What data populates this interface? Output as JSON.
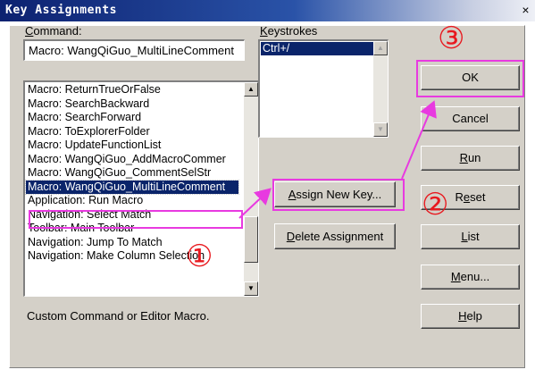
{
  "window": {
    "title": "Key Assignments",
    "close_glyph": "×"
  },
  "command": {
    "label_pre": "",
    "label_u": "C",
    "label_post": "ommand:",
    "value": "Macro: WangQiGuo_MultiLineComment"
  },
  "commands_list": {
    "items": [
      "Macro: ReturnTrueOrFalse",
      "Macro: SearchBackward",
      "Macro: SearchForward",
      "Macro: ToExplorerFolder",
      "Macro: UpdateFunctionList",
      "Macro: WangQiGuo_AddMacroCommer",
      "Macro: WangQiGuo_CommentSelStr",
      "Macro: WangQiGuo_MultiLineComment",
      "Application: Run Macro",
      "Navigation: Select Match",
      "Toolbar: Main Toolbar",
      "Navigation: Jump To Match",
      "Navigation: Make Column Selection"
    ],
    "selected_index": 7
  },
  "keystrokes": {
    "label_u": "K",
    "label_post": "eystrokes",
    "items": [
      "Ctrl+/"
    ]
  },
  "buttons": {
    "assign_pre": "",
    "assign_u": "A",
    "assign_post": "ssign New Key...",
    "delete_pre": "",
    "delete_u": "D",
    "delete_post": "elete Assignment",
    "ok": "OK",
    "cancel": "Cancel",
    "run_u": "R",
    "run_post": "un",
    "reset_pre": "R",
    "reset_u": "e",
    "reset_post": "set",
    "list_u": "L",
    "list_post": "ist",
    "menu_pre": "",
    "menu_u": "M",
    "menu_post": "enu...",
    "help_u": "H",
    "help_post": "elp"
  },
  "status_text": "Custom Command or Editor Macro.",
  "annotations": {
    "step1": "①",
    "step2": "②",
    "step3": "③",
    "color": "#e83ae0",
    "number_color": "#e8191f"
  },
  "icons": {
    "scroll_up": "▲",
    "scroll_down": "▼"
  }
}
